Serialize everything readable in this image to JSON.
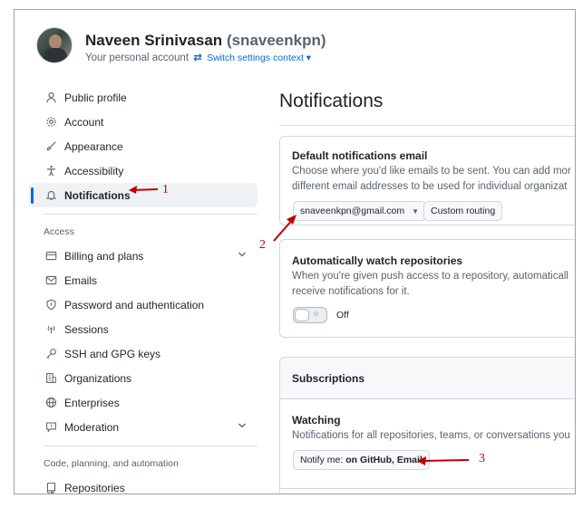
{
  "user": {
    "name": "Naveen Srinivasan",
    "login": "(snaveenkpn)",
    "subtitle": "Your personal account",
    "switch_icon": "⇄",
    "switch_label": "Switch settings context ▾"
  },
  "sidebar": {
    "items": [
      {
        "label": "Public profile",
        "icon": "person-icon"
      },
      {
        "label": "Account",
        "icon": "gear-icon"
      },
      {
        "label": "Appearance",
        "icon": "paintbrush-icon"
      },
      {
        "label": "Accessibility",
        "icon": "accessibility-icon"
      },
      {
        "label": "Notifications",
        "icon": "bell-icon",
        "active": true
      }
    ],
    "access_heading": "Access",
    "access_items": [
      {
        "label": "Billing and plans",
        "icon": "credit-card-icon"
      },
      {
        "label": "Emails",
        "icon": "mail-icon"
      },
      {
        "label": "Password and authentication",
        "icon": "shield-icon"
      },
      {
        "label": "Sessions",
        "icon": "broadcast-icon"
      },
      {
        "label": "SSH and GPG keys",
        "icon": "key-icon"
      },
      {
        "label": "Organizations",
        "icon": "organization-icon"
      },
      {
        "label": "Enterprises",
        "icon": "globe-icon"
      },
      {
        "label": "Moderation",
        "icon": "report-icon"
      }
    ],
    "code_heading": "Code, planning, and automation",
    "code_items": [
      {
        "label": "Repositories",
        "icon": "repo-icon"
      }
    ]
  },
  "main": {
    "title": "Notifications",
    "default_email": {
      "title": "Default notifications email",
      "line1": "Choose where you'd like emails to be sent. You can add mor",
      "line2": "different email addresses to be used for individual organizat",
      "email_value": "snaveenkpn@gmail.com",
      "custom_routing_label": "Custom routing"
    },
    "watch_repos": {
      "title": "Automatically watch repositories",
      "line1": "When you're given push access to a repository, automaticall",
      "line2": "receive notifications for it.",
      "toggle_state": "Off"
    },
    "subscriptions": {
      "header": "Subscriptions",
      "watching_title": "Watching",
      "watching_text": "Notifications for all repositories, teams, or conversations you",
      "notify_prefix": "Notify me:",
      "notify_value": "on GitHub, Email"
    }
  },
  "annotations": {
    "one": "1",
    "two": "2",
    "three": "3",
    "color": "#c00000"
  }
}
